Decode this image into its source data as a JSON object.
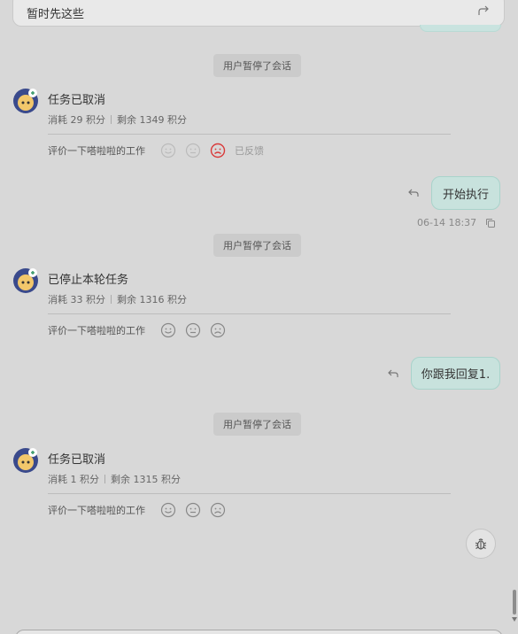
{
  "top_card": {
    "text": "暂时先这些",
    "icon": "share-arrow-icon"
  },
  "system_notice": "用户暂停了会话",
  "rating_label": "评价一下嗒啦啦的工作",
  "messages": {
    "bot1": {
      "title": "任务已取消",
      "consumed": "消耗 29 积分",
      "remaining": "剩余 1349 积分",
      "feedback": "已反馈"
    },
    "user1": {
      "text": "开始执行",
      "time": "06-14 18:37"
    },
    "bot2": {
      "title": "已停止本轮任务",
      "consumed": "消耗 33 积分",
      "remaining": "剩余 1316 积分"
    },
    "user2": {
      "text": "你跟我回复1."
    },
    "bot3": {
      "title": "任务已取消",
      "consumed": "消耗 1 积分",
      "remaining": "剩余 1315 积分"
    }
  },
  "colors": {
    "user_bubble": "#c8e2dd",
    "negative_selected": "#d93a3a"
  },
  "icons": [
    "reply-icon",
    "copy-icon",
    "smile-icon",
    "neutral-icon",
    "frown-icon",
    "bug-icon"
  ]
}
